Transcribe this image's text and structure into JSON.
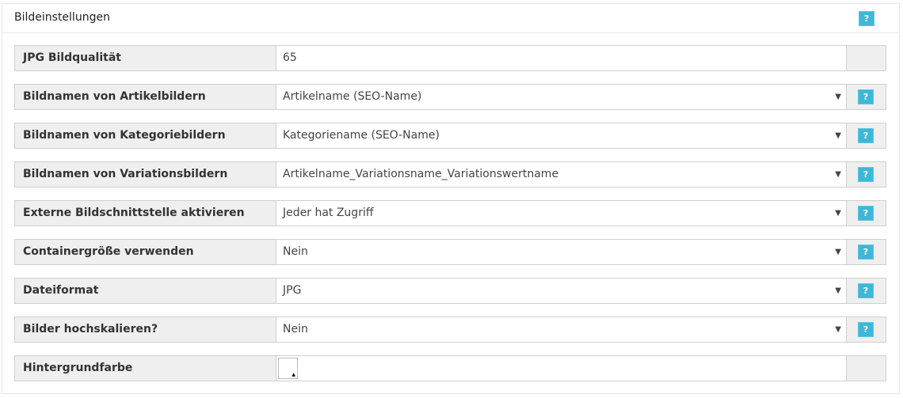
{
  "panel": {
    "title": "Bildeinstellungen",
    "help_label": "?"
  },
  "rows": [
    {
      "label": "JPG Bildqualität",
      "value": "65",
      "type": "text"
    },
    {
      "label": "Bildnamen von Artikelbildern",
      "value": "Artikelname (SEO-Name)",
      "type": "select",
      "help": "?"
    },
    {
      "label": "Bildnamen von Kategoriebildern",
      "value": "Kategoriename (SEO-Name)",
      "type": "select",
      "help": "?"
    },
    {
      "label": "Bildnamen von Variationsbildern",
      "value": "Artikelname_Variationsname_Variationswertname",
      "type": "select",
      "help": "?"
    },
    {
      "label": "Externe Bildschnittstelle aktivieren",
      "value": "Jeder hat Zugriff",
      "type": "select",
      "help": "?"
    },
    {
      "label": "Containergröße verwenden",
      "value": "Nein",
      "type": "select",
      "help": "?"
    },
    {
      "label": "Dateiformat",
      "value": "JPG",
      "type": "select",
      "help": "?"
    },
    {
      "label": "Bilder hochskalieren?",
      "value": "Nein",
      "type": "select",
      "help": "?"
    },
    {
      "label": "Hintergrundfarbe",
      "value": "#ffffff",
      "type": "color"
    }
  ],
  "colors": {
    "help_button": "#3fb7d7",
    "label_background": "#efefef",
    "border": "#cfcfcf"
  },
  "icons": {
    "dropdown": "chevron-down-icon",
    "help": "help-icon"
  }
}
